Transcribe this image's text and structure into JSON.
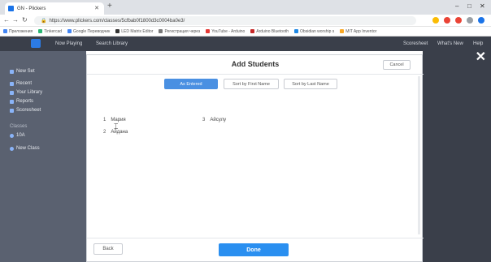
{
  "browser": {
    "tab_title": "GN - Plickers",
    "new_tab_symbol": "+",
    "url": "https://www.plickers.com/classes/5cfbab0f1800d3c0004ba0e3/",
    "window_controls": [
      "–",
      "□",
      "✕"
    ],
    "nav_icons": [
      "back-arrow-icon",
      "forward-arrow-icon",
      "reload-icon",
      "lock-icon"
    ],
    "bookmarks": [
      {
        "label": "Приложения",
        "color": "#4285f4"
      },
      {
        "label": "Tinkercad",
        "color": "#2bb673"
      },
      {
        "label": "Google Переводчик",
        "color": "#4285f4"
      },
      {
        "label": "LED Matrix Editor",
        "color": "#333333"
      },
      {
        "label": "Регистрация через",
        "color": "#777777"
      },
      {
        "label": "YouTube - Arduino",
        "color": "#e53935"
      },
      {
        "label": "Arduino Bluetooth",
        "color": "#c62828"
      },
      {
        "label": "Obsidian worship s",
        "color": "#1e88e5"
      },
      {
        "label": "MIT App Inventor",
        "color": "#f9a825"
      }
    ],
    "extension_colors": [
      "#fbbc04",
      "#ea4335",
      "#ea4335",
      "#9aa0a6",
      "#1a73e8"
    ]
  },
  "app": {
    "topbar": {
      "now_playing": "Now Playing",
      "search": "Search Library",
      "right_link_1": "Scoresheet",
      "right_link_2": "What's New",
      "right_link_3": "Help"
    },
    "sidebar": [
      {
        "label": "New Set"
      },
      {
        "label": "Recent"
      },
      {
        "label": "Your Library"
      },
      {
        "label": "Reports"
      },
      {
        "label": "Scoresheet"
      },
      {
        "label": "Classes"
      },
      {
        "label": "10A"
      },
      {
        "label": "New Class"
      }
    ]
  },
  "modal": {
    "title": "Add Students",
    "cancel_label": "Cancel",
    "sort_options": [
      {
        "label": "As Entered",
        "active": true
      },
      {
        "label": "Sort by First Name",
        "active": false
      },
      {
        "label": "Sort by Last Name",
        "active": false
      }
    ],
    "students": [
      {
        "number": "1",
        "name": "Мария"
      },
      {
        "number": "2",
        "name": "Айдана"
      },
      {
        "number": "3",
        "name": "Айсулу"
      }
    ],
    "back_label": "Back",
    "done_label": "Done",
    "accent_color": "#2a8ff0"
  }
}
